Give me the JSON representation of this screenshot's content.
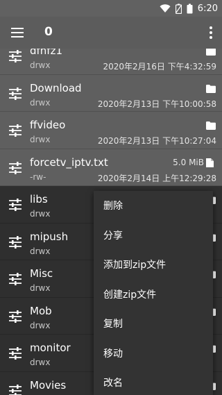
{
  "status": {
    "time": "6:20"
  },
  "appbar": {
    "count": "0"
  },
  "files": [
    {
      "name": "dfhfz1",
      "perm": "drwx",
      "date": "2020年2月16日 下午4:32:59",
      "type": "folder",
      "selected": true
    },
    {
      "name": "Download",
      "perm": "drwx",
      "date": "2020年2月13日 下午10:00:58",
      "type": "folder",
      "selected": true
    },
    {
      "name": "ffvideo",
      "perm": "drwx",
      "date": "2020年2月13日 下午10:27:04",
      "type": "folder",
      "selected": true
    },
    {
      "name": "forcetv_iptv.txt",
      "perm": "-rw-",
      "date": "2020年2月14日 上午12:29:28",
      "type": "file",
      "size": "5.0 MiB",
      "selected": true
    },
    {
      "name": "libs",
      "perm": "drwx",
      "date": "",
      "type": "folder",
      "selected": false
    },
    {
      "name": "mipush",
      "perm": "drwx",
      "date": "",
      "type": "folder",
      "selected": false
    },
    {
      "name": "Misc",
      "perm": "drwx",
      "date": "",
      "type": "folder",
      "selected": false
    },
    {
      "name": "Mob",
      "perm": "drwx",
      "date": "",
      "type": "folder",
      "selected": false
    },
    {
      "name": "monitor",
      "perm": "drwx",
      "date": "",
      "type": "folder",
      "selected": false
    },
    {
      "name": "Movies",
      "perm": "",
      "date": "",
      "type": "folder",
      "selected": false
    }
  ],
  "context_menu": {
    "items": [
      "删除",
      "分享",
      "添加到zip文件",
      "创建zip文件",
      "复制",
      "移动",
      "改名"
    ]
  }
}
